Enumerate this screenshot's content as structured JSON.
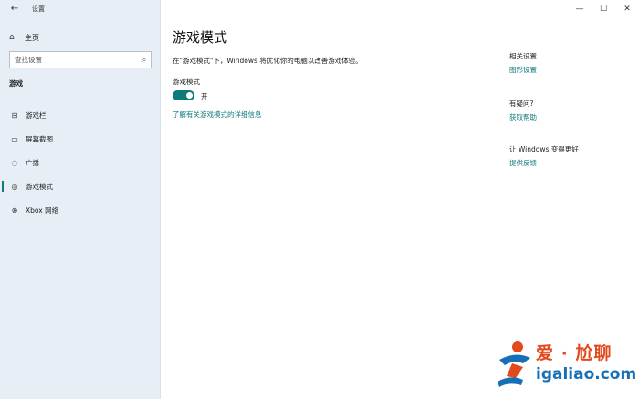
{
  "window": {
    "title": "设置",
    "controls": [
      "—",
      "☐",
      "✕"
    ]
  },
  "sidebar": {
    "home_label": "主页",
    "search_placeholder": "查找设置",
    "section": "游戏",
    "items": [
      {
        "label": "游戏栏",
        "icon": "gamebar-icon"
      },
      {
        "label": "屏幕截图",
        "icon": "capture-icon"
      },
      {
        "label": "广播",
        "icon": "broadcast-icon"
      },
      {
        "label": "游戏模式",
        "icon": "gamemode-icon",
        "active": true
      },
      {
        "label": "Xbox 网络",
        "icon": "xbox-icon"
      }
    ]
  },
  "main": {
    "title": "游戏模式",
    "description": "在\"游戏模式\"下，Windows 将优化你的电脑以改善游戏体验。",
    "toggle_label": "游戏模式",
    "toggle_state": "开",
    "learn_more": "了解有关游戏模式的详细信息"
  },
  "related": {
    "heading1": "相关设置",
    "link1": "图形设置",
    "heading2": "有疑问?",
    "link2": "获取帮助",
    "heading3": "让 Windows 变得更好",
    "link3": "提供反馈"
  },
  "watermark": {
    "line1": "爱 · 尬聊",
    "line2": "igaliao.com"
  },
  "colors": {
    "accent": "#0f7a7a",
    "sidebar_bg": "#e7eef6",
    "watermark_red": "#e24a1d",
    "watermark_blue": "#1670b8"
  }
}
